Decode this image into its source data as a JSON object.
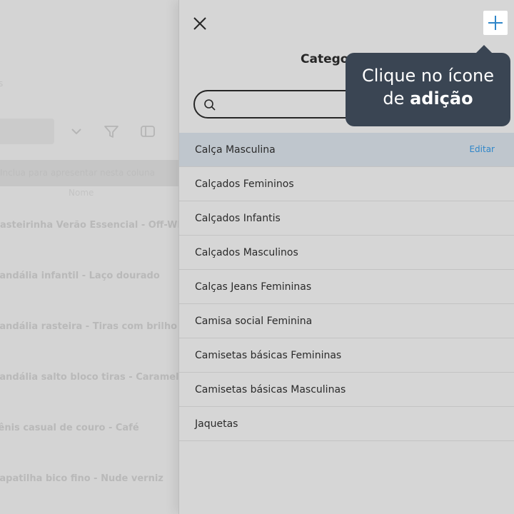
{
  "background": {
    "hint_text": "Inclua para apresentar nesta coluna",
    "column_header": "Nome",
    "products": [
      "Rasteirinha Verão Essencial - Off-White",
      "Sandália infantil - Laço dourado",
      "Sandália rasteira - Tiras com brilho dourado",
      "Sandália salto bloco tiras - Caramelo",
      "Tênis casual de couro - Café",
      "Sapatilha bico fino - Nude verniz"
    ],
    "side_label": "s"
  },
  "drawer": {
    "title": "Categorias",
    "search": {
      "value": "",
      "placeholder": ""
    },
    "edit_label": "Editar",
    "categories": [
      "Calça Masculina",
      "Calçados Femininos",
      "Calçados Infantis",
      "Calçados Masculinos",
      "Calças Jeans Femininas",
      "Camisa social Feminina",
      "Camisetas básicas Femininas",
      "Camisetas básicas Masculinas",
      "Jaquetas"
    ],
    "selected_index": 0
  },
  "tooltip": {
    "line1": "Clique no ícone",
    "line2_prefix": "de ",
    "line2_bold": "adição"
  },
  "icons": {
    "close": "close-icon",
    "add": "plus-icon",
    "search": "search-icon",
    "filter": "filter-icon",
    "chevron": "chevron-down-icon",
    "panel": "panel-icon"
  },
  "colors": {
    "accent_blue": "#2f86c9",
    "tooltip_bg": "#3a4553",
    "selected_row": "#bfc6cd"
  }
}
